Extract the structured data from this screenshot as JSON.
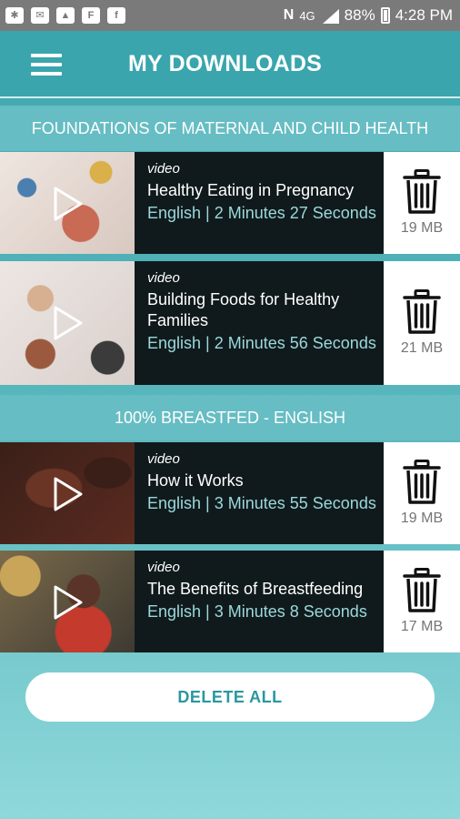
{
  "status_bar": {
    "battery": "88%",
    "time": "4:28 PM",
    "notification_icons": [
      "slack-icon",
      "mail-icon",
      "image-icon",
      "flipboard-icon",
      "facebook-icon"
    ]
  },
  "header": {
    "title": "MY DOWNLOADS"
  },
  "sections": [
    {
      "title": "FOUNDATIONS OF MATERNAL AND CHILD HEALTH",
      "videos": [
        {
          "label": "video",
          "title": "Healthy Eating in Pregnancy",
          "meta": "English |  2 Minutes 27 Seconds",
          "size": "19 MB"
        },
        {
          "label": "video",
          "title": "Building Foods for Healthy Families",
          "meta": "English |  2 Minutes 56 Seconds",
          "size": "21 MB"
        }
      ]
    },
    {
      "title": "100% BREASTFED - ENGLISH",
      "videos": [
        {
          "label": "video",
          "title": "How it Works",
          "meta": "English |  3 Minutes 55 Seconds",
          "size": "19 MB"
        },
        {
          "label": "video",
          "title": "The Benefits of Breastfeeding",
          "meta": "English |  3 Minutes 8 Seconds",
          "size": "17 MB"
        }
      ]
    }
  ],
  "delete_all_label": "DELETE ALL",
  "colors": {
    "teal": "#3aa5ad",
    "section": "#66bdc3",
    "info_bg": "#101a1c",
    "meta_text": "#9cd8dc"
  }
}
